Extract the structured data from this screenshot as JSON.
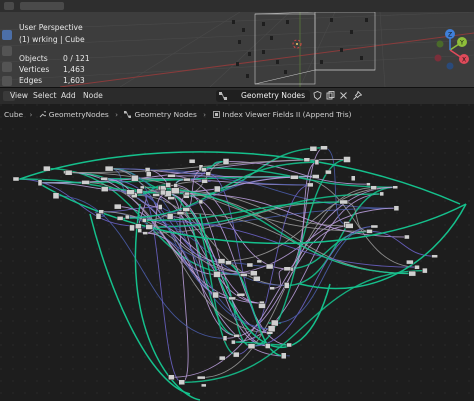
{
  "viewport": {
    "view_name": "User Perspective",
    "object_line": "(1) wrking | Cube",
    "stats": [
      {
        "label": "Objects",
        "value": "0 / 121"
      },
      {
        "label": "Vertices",
        "value": "1,463"
      },
      {
        "label": "Edges",
        "value": "1,603"
      }
    ],
    "gizmo_axes": [
      "Y",
      "X",
      "Z"
    ]
  },
  "node_editor": {
    "menu": [
      "View",
      "Select",
      "Add",
      "Node"
    ],
    "node_tree_name": "Geometry Nodes",
    "breadcrumb": [
      "Cube",
      "GeometryNodes",
      "Geometry Nodes",
      "Index Viewer Fields II (Append Tris)"
    ],
    "colors": {
      "background": "#1d1d1d",
      "geometry_link": "#15c08c",
      "field_link": "#b89cd9",
      "int_link": "#4a5ca8",
      "float_link": "#9a9a9a",
      "vector_link": "#6b63c7",
      "node": "#cfcfcf"
    }
  }
}
